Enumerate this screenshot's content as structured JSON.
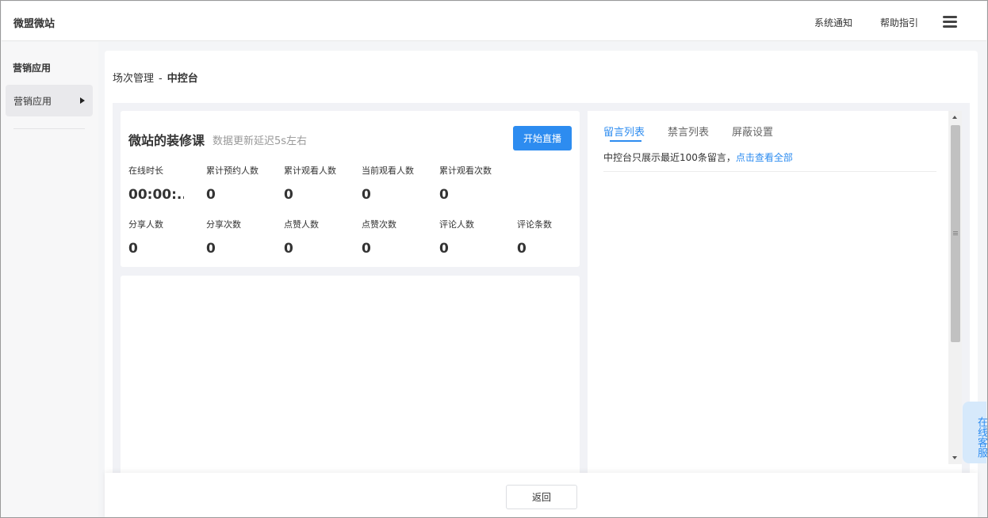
{
  "header": {
    "brand": "微盟微站",
    "nav": [
      "系统通知",
      "帮助指引"
    ]
  },
  "sidebar": {
    "title": "营销应用",
    "items": [
      {
        "label": "营销应用"
      }
    ]
  },
  "breadcrumb": {
    "parent": "场次管理",
    "separator": "-",
    "current": "中控台"
  },
  "stats": {
    "course_title": "微站的装修课",
    "subtitle": "数据更新延迟5s左右",
    "start_button": "开始直播",
    "row1": [
      {
        "label": "在线时长",
        "value": "00:00:..."
      },
      {
        "label": "累计预约人数",
        "value": "0"
      },
      {
        "label": "累计观看人数",
        "value": "0"
      },
      {
        "label": "当前观看人数",
        "value": "0"
      },
      {
        "label": "累计观看次数",
        "value": "0"
      }
    ],
    "row2": [
      {
        "label": "分享人数",
        "value": "0"
      },
      {
        "label": "分享次数",
        "value": "0"
      },
      {
        "label": "点赞人数",
        "value": "0"
      },
      {
        "label": "点赞次数",
        "value": "0"
      },
      {
        "label": "评论人数",
        "value": "0"
      },
      {
        "label": "评论条数",
        "value": "0"
      }
    ]
  },
  "comments": {
    "tabs": [
      {
        "label": "留言列表",
        "active": true
      },
      {
        "label": "禁言列表",
        "active": false
      },
      {
        "label": "屏蔽设置",
        "active": false
      }
    ],
    "notice": "中控台只展示最近100条留言，",
    "notice_link": "点击查看全部"
  },
  "footer": {
    "back_button": "返回"
  },
  "service": {
    "label": "在线客服"
  },
  "colors": {
    "accent": "#2d8cf0",
    "background": "#f4f5f7"
  }
}
